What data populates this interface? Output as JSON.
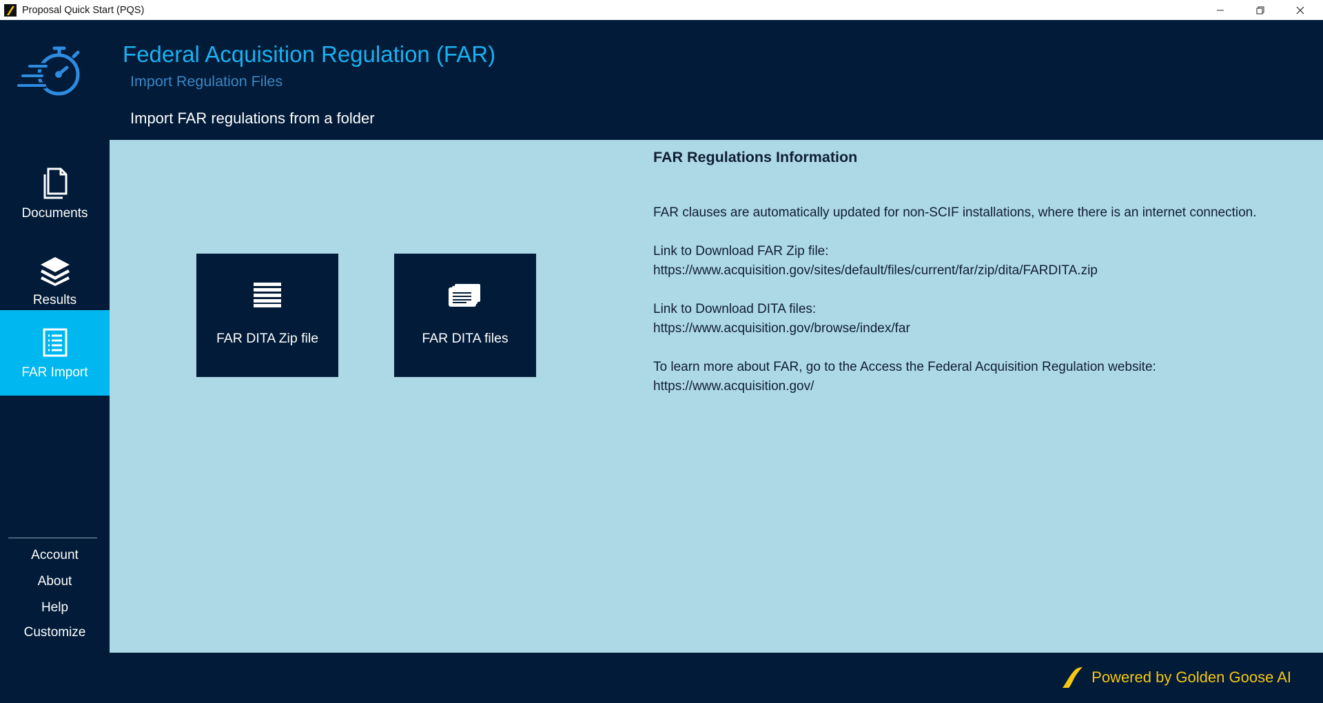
{
  "window": {
    "title": "Proposal Quick Start (PQS)",
    "controls": {
      "minimize": "—",
      "maximize": "❐",
      "close": "✕"
    }
  },
  "sidebar": {
    "items": [
      {
        "label": "Documents",
        "icon": "document-icon",
        "active": false
      },
      {
        "label": "Results",
        "icon": "layers-icon",
        "active": false
      },
      {
        "label": "FAR Import",
        "icon": "list-page-icon",
        "active": true
      }
    ],
    "bottom_links": [
      "Account",
      "About",
      "Help",
      "Customize"
    ]
  },
  "header": {
    "title": "Federal Acquisition Regulation (FAR)",
    "subtitle": "Import Regulation Files",
    "description": "Import FAR regulations from a folder"
  },
  "tiles": [
    {
      "label": "FAR DITA Zip file",
      "icon": "stacked-lines-icon"
    },
    {
      "label": "FAR DITA files",
      "icon": "files-stack-icon"
    }
  ],
  "info": {
    "title": "FAR Regulations Information",
    "auto_update": "FAR clauses are automatically updated for non-SCIF installations, where there is an internet connection.",
    "zip_link_label": "Link to Download FAR Zip file:",
    "zip_link_url": "https://www.acquisition.gov/sites/default/files/current/far/zip/dita/FARDITA.zip",
    "dita_link_label": "Link to Download DITA files:",
    "dita_link_url": "https://www.acquisition.gov/browse/index/far",
    "learn_more": "To learn more about FAR, go to the Access the Federal Acquisition Regulation website:",
    "learn_more_url": "https://www.acquisition.gov/"
  },
  "footer": {
    "powered_by": "Powered by Golden Goose AI"
  },
  "colors": {
    "navy": "#011b38",
    "accent_blue": "#1ab1f0",
    "active_nav": "#00b8ef",
    "panel_bg": "#add8e6",
    "gold": "#f5c612"
  }
}
